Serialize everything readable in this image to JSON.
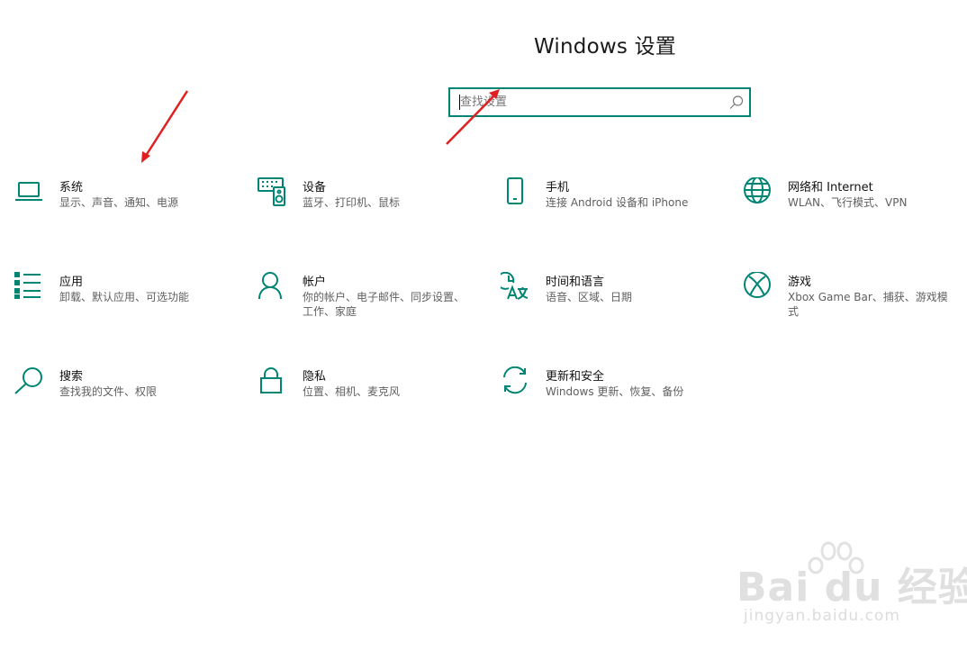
{
  "header": {
    "title": "Windows 设置"
  },
  "search": {
    "placeholder": "查找设置"
  },
  "tiles": [
    {
      "name": "系统",
      "desc": "显示、声音、通知、电源",
      "icon": "laptop-icon"
    },
    {
      "name": "设备",
      "desc": "蓝牙、打印机、鼠标",
      "icon": "devices-icon"
    },
    {
      "name": "手机",
      "desc": "连接 Android 设备和 iPhone",
      "icon": "phone-icon"
    },
    {
      "name": "网络和 Internet",
      "desc": "WLAN、飞行模式、VPN",
      "icon": "globe-icon"
    },
    {
      "name": "应用",
      "desc": "卸载、默认应用、可选功能",
      "icon": "apps-list-icon"
    },
    {
      "name": "帐户",
      "desc": "你的帐户、电子邮件、同步设置、工作、家庭",
      "icon": "person-icon"
    },
    {
      "name": "时间和语言",
      "desc": "语音、区域、日期",
      "icon": "time-language-icon"
    },
    {
      "name": "游戏",
      "desc": "Xbox Game Bar、捕获、游戏模式",
      "icon": "xbox-icon"
    },
    {
      "name": "搜索",
      "desc": "查找我的文件、权限",
      "icon": "search-icon"
    },
    {
      "name": "隐私",
      "desc": "位置、相机、麦克风",
      "icon": "lock-icon"
    },
    {
      "name": "更新和安全",
      "desc": "Windows 更新、恢复、备份",
      "icon": "sync-icon"
    }
  ],
  "watermark": {
    "main": "Bai du 经验",
    "sub": "jingyan.baidu.com"
  },
  "colors": {
    "accent": "#008575",
    "annotation_arrow": "#e02020"
  }
}
